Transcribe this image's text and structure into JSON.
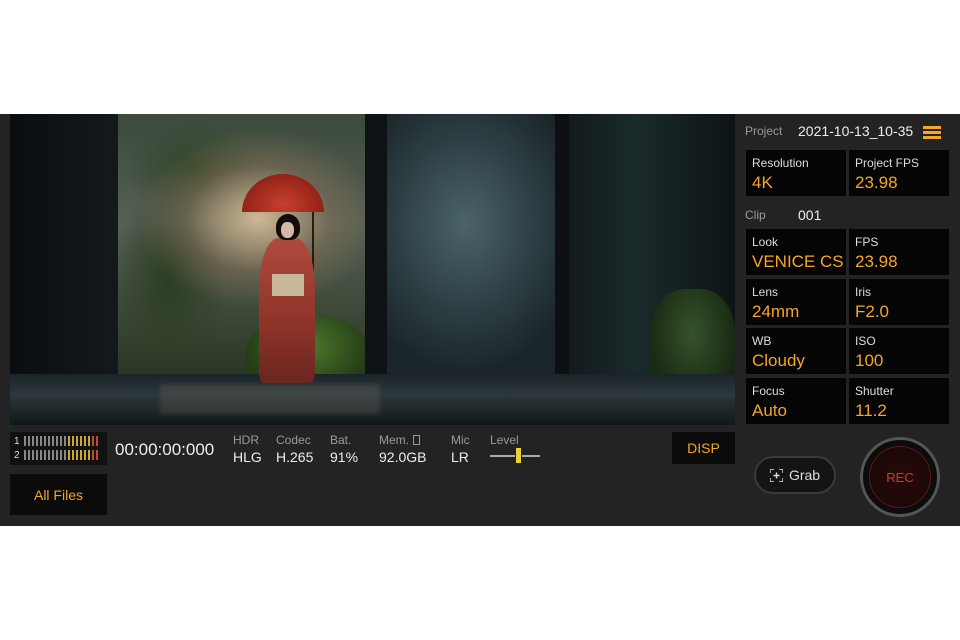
{
  "viewfinder": {
    "description_icon": "camera-preview"
  },
  "audio_meter": {
    "channels": [
      "1",
      "2"
    ]
  },
  "timecode": "00:00:00:000",
  "stats": {
    "hdr": {
      "label": "HDR",
      "value": "HLG"
    },
    "codec": {
      "label": "Codec",
      "value": "H.265"
    },
    "battery": {
      "label": "Bat.",
      "value": "91%"
    },
    "memory": {
      "label": "Mem.",
      "value": "92.0GB",
      "icon": "sd-card-icon"
    },
    "mic": {
      "label": "Mic",
      "value": "LR"
    },
    "level": {
      "label": "Level",
      "value": 0.55
    }
  },
  "buttons": {
    "disp": "DISP",
    "all_files": "All Files",
    "grab": "Grab",
    "rec": "REC"
  },
  "project": {
    "label": "Project",
    "value": "2021-10-13_10-35"
  },
  "clip": {
    "label": "Clip",
    "value": "001"
  },
  "settings": {
    "resolution": {
      "label": "Resolution",
      "value": "4K"
    },
    "project_fps": {
      "label": "Project FPS",
      "value": "23.98"
    },
    "look": {
      "label": "Look",
      "value": "VENICE CS"
    },
    "fps": {
      "label": "FPS",
      "value": "23.98"
    },
    "lens": {
      "label": "Lens",
      "value": "24mm"
    },
    "iris": {
      "label": "Iris",
      "value": "F2.0"
    },
    "wb": {
      "label": "WB",
      "value": "Cloudy"
    },
    "iso": {
      "label": "ISO",
      "value": "100"
    },
    "focus": {
      "label": "Focus",
      "value": "Auto"
    },
    "shutter": {
      "label": "Shutter",
      "value": "11.2"
    }
  },
  "colors": {
    "accent": "#f5a623",
    "rec": "#d03a2a",
    "background": "#232323"
  }
}
